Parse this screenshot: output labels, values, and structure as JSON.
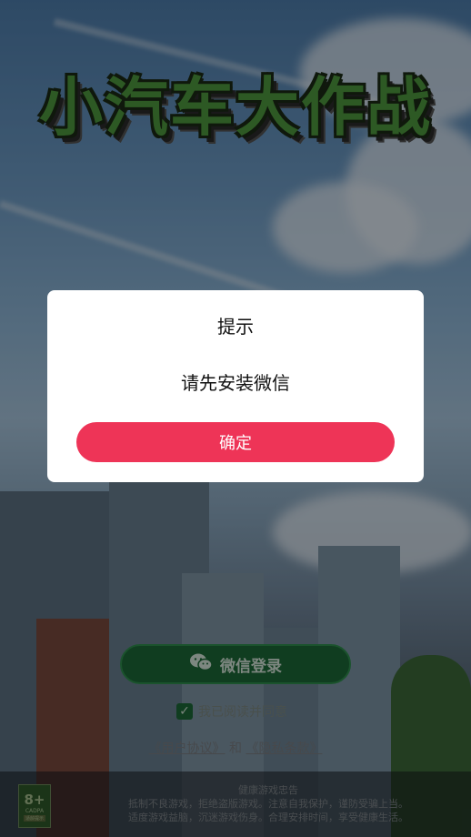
{
  "game": {
    "title": "小汽车大作战"
  },
  "login": {
    "button_label": "微信登录",
    "button_icon": "wechat-icon",
    "button_color": "#1d6a37"
  },
  "agreement": {
    "checked": true,
    "label": "我已阅读并同意",
    "user_agreement": "《用户协议》",
    "conjunction": "和",
    "privacy_policy": "《隐私条款》"
  },
  "footer": {
    "age_rating": "8+",
    "age_rating_sub": "CADPA",
    "age_rating_tag": "适龄提示",
    "advice_title": "健康游戏忠告",
    "advice_line1": "抵制不良游戏，拒绝盗版游戏。注意自我保护，谨防受骗上当。",
    "advice_line2": "适度游戏益脑，沉迷游戏伤身。合理安排时间，享受健康生活。"
  },
  "dialog": {
    "title": "提示",
    "message": "请先安装微信",
    "confirm_label": "确定",
    "confirm_color": "#ee3457"
  }
}
